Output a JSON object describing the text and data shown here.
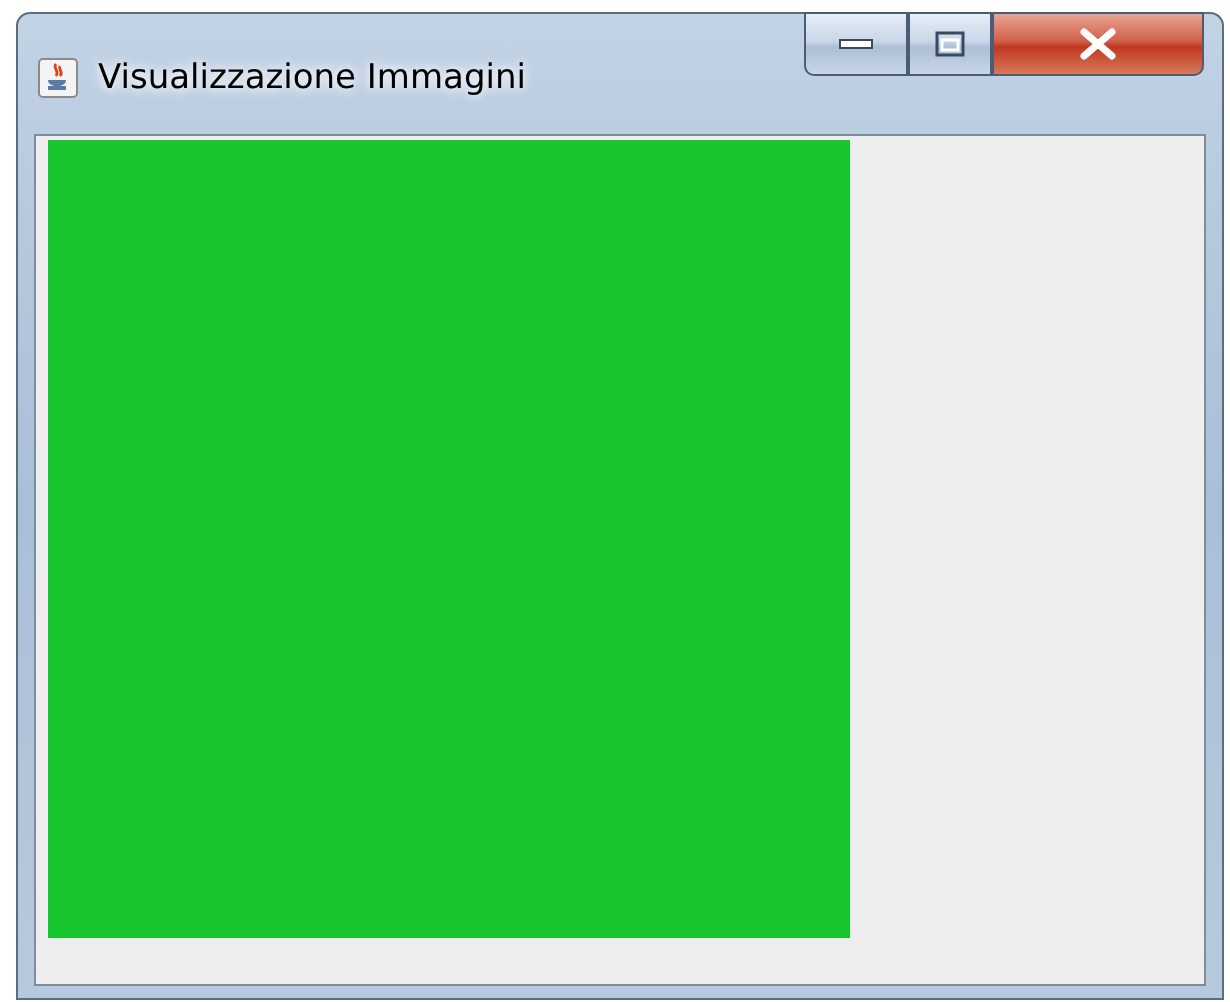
{
  "window": {
    "title": "Visualizzazione Immagini"
  }
}
